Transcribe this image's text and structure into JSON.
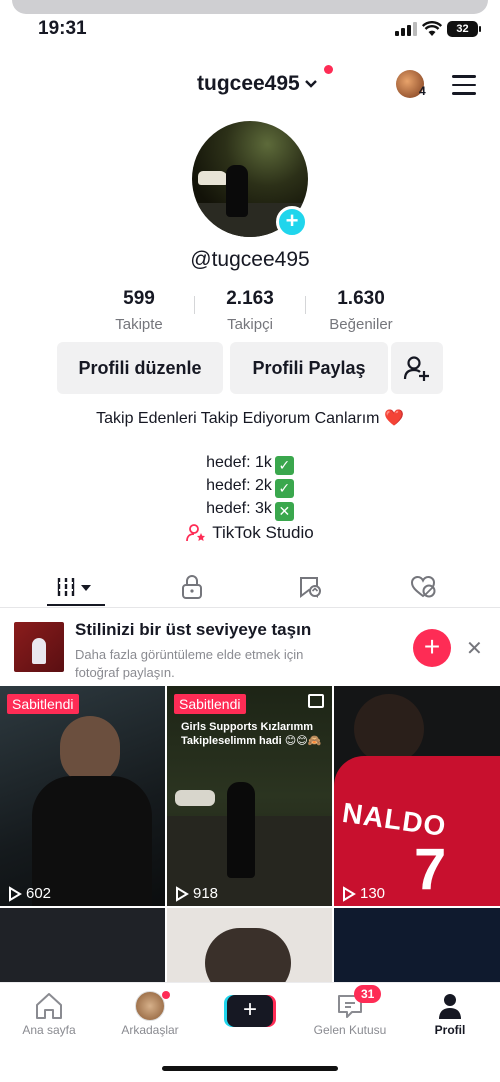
{
  "status_bar": {
    "time": "19:31",
    "battery": "32"
  },
  "header": {
    "username": "tugcee495",
    "avatar_badge_count": "4"
  },
  "profile": {
    "handle": "@tugcee495",
    "stats": [
      {
        "value": "599",
        "label": "Takipte"
      },
      {
        "value": "2.163",
        "label": "Takipçi"
      },
      {
        "value": "1.630",
        "label": "Beğeniler"
      }
    ],
    "buttons": {
      "edit": "Profili düzenle",
      "share": "Profili Paylaş"
    },
    "bio": "Takip Edenleri Takip Ediyorum Canlarım ❤️",
    "goals": [
      {
        "text": "hedef: 1k",
        "status": "✓"
      },
      {
        "text": "hedef: 2k",
        "status": "✓"
      },
      {
        "text": "hedef: 3k",
        "status": "✕"
      }
    ],
    "studio": "TikTok Studio"
  },
  "tabs": [
    "videos-grid-icon",
    "lock-icon",
    "repost-icon",
    "liked-heart-icon"
  ],
  "banner": {
    "title": "Stilinizi bir üst seviyeye taşın",
    "subtitle": "Daha fazla görüntüleme elde etmek için fotoğraf paylaşın."
  },
  "grid": [
    {
      "pinned": "Sabitlendi",
      "views": "602",
      "overlay": ""
    },
    {
      "pinned": "Sabitlendi",
      "views": "918",
      "overlay": "Girls Supports Kızlarımm\nTakipleselimm hadi 😊😊🙈"
    },
    {
      "pinned": "",
      "views": "130",
      "overlay": ""
    }
  ],
  "bottom_nav": {
    "home": "Ana sayfa",
    "friends": "Arkadaşlar",
    "inbox": "Gelen Kutusu",
    "inbox_badge": "31",
    "profile": "Profil"
  },
  "colors": {
    "accent": "#fe2c55",
    "cyan": "#20d5ec",
    "text": "#161823",
    "muted": "#75767c"
  }
}
